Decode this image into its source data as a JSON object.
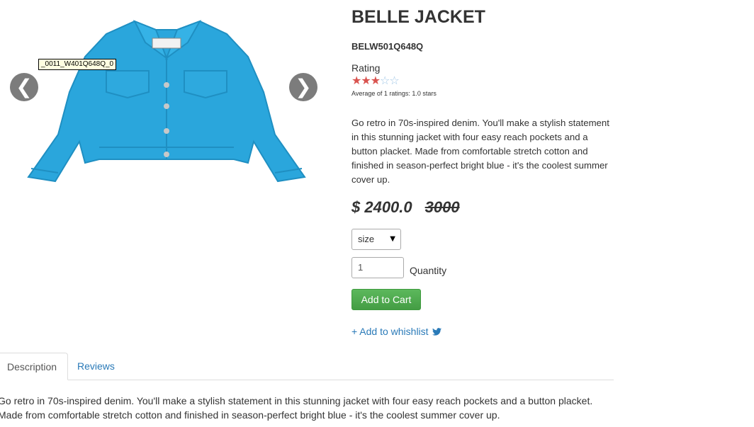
{
  "gallery": {
    "image_label": "_0011_W401Q648Q_0",
    "prev_icon": "❮",
    "next_icon": "❯",
    "jacket_color": "#2aa6dc"
  },
  "product": {
    "title": "BELLE JACKET",
    "sku": "BELW501Q648Q",
    "rating_label": "Rating",
    "rating_value": 3,
    "rating_max": 5,
    "rating_stars_on": "★★★",
    "rating_stars_off": "☆☆",
    "rating_summary": "Average of 1 ratings: 1.0 stars",
    "description": "Go retro in 70s-inspired denim. You'll make a stylish statement in this stunning jacket with four easy reach pockets and a button placket. Made from comfortable stretch cotton and finished in season-perfect bright blue - it's the coolest summer cover up.",
    "price": "$ 2400.0",
    "old_price": "3000"
  },
  "form": {
    "size_selected": "size",
    "size_arrow": "▼",
    "quantity_value": "1",
    "quantity_label": "Quantity",
    "add_to_cart_label": "Add to Cart",
    "wishlist_label": "+ Add to whishlist"
  },
  "tabs": {
    "items": [
      {
        "label": "Description",
        "active": true
      },
      {
        "label": "Reviews",
        "active": false
      }
    ],
    "content": "Go retro in 70s-inspired denim. You'll make a stylish statement in this stunning jacket with four easy reach pockets and a button placket. Made from comfortable stretch cotton and finished in season-perfect bright blue - it's the coolest summer cover up."
  },
  "colors": {
    "accent": "#2a7ab8",
    "cart_button": "#5cb85c",
    "star_on": "#d9534f",
    "star_off": "#9fc6e6"
  }
}
